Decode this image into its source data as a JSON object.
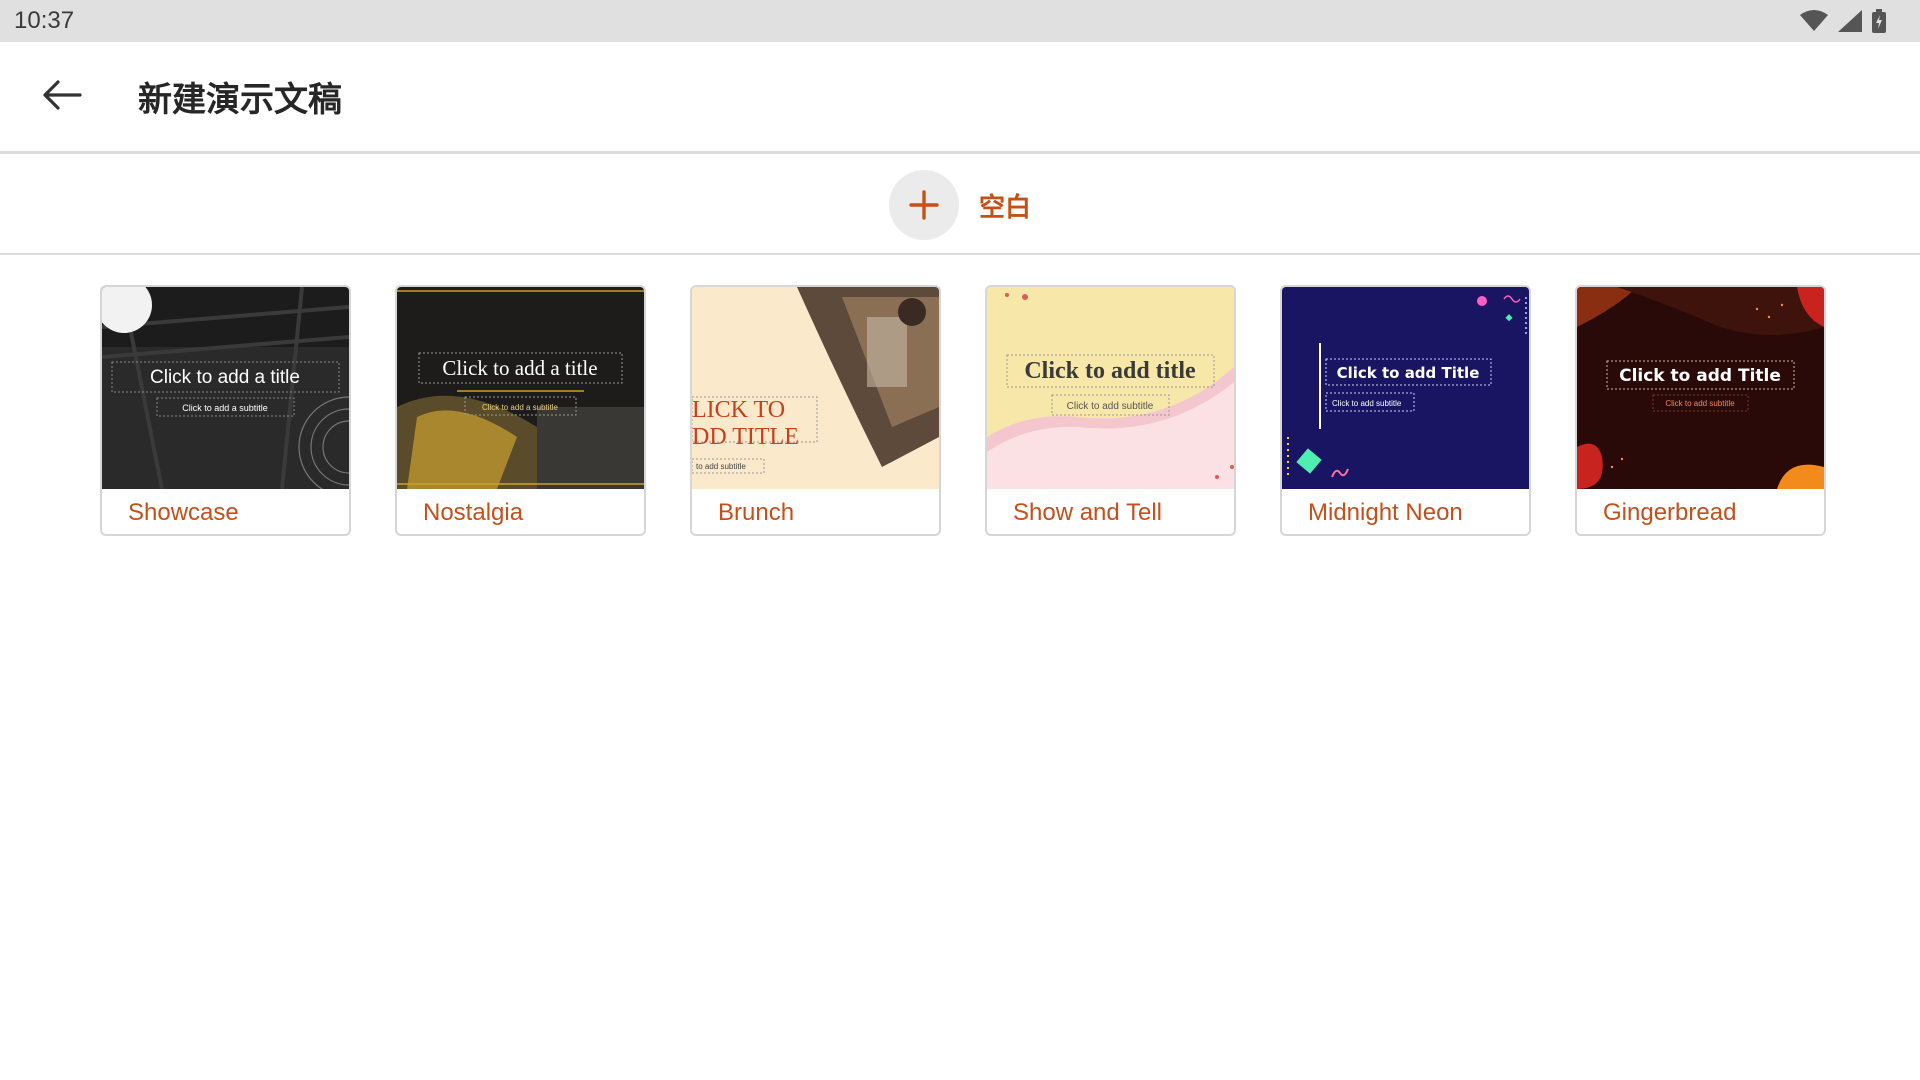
{
  "status_bar": {
    "time": "10:37",
    "icons": [
      "wifi-icon",
      "signal-icon",
      "battery-icon"
    ]
  },
  "app_bar": {
    "back_icon": "arrow-left-icon",
    "title": "新建演示文稿"
  },
  "blank": {
    "icon": "plus-icon",
    "label": "空白"
  },
  "colors": {
    "accent": "#c4501a",
    "divider": "#dcdcdc",
    "status_bar_bg": "#e0e0e0"
  },
  "templates": [
    {
      "name": "Showcase",
      "thumb_title": "Click to add a title",
      "thumb_subtitle": "Click to add a subtitle"
    },
    {
      "name": "Nostalgia",
      "thumb_title": "Click to add a title",
      "thumb_subtitle": "Click to add a subtitle"
    },
    {
      "name": "Brunch",
      "thumb_title_line1": "LICK TO",
      "thumb_title_line2": "DD TITLE",
      "thumb_subtitle": "to add subtitle"
    },
    {
      "name": "Show and Tell",
      "thumb_title": "Click to add title",
      "thumb_subtitle": "Click to add subtitle"
    },
    {
      "name": "Midnight Neon",
      "thumb_title": "Click to add Title",
      "thumb_subtitle": "Click to add subtitle"
    },
    {
      "name": "Gingerbread",
      "thumb_title": "Click to add Title",
      "thumb_subtitle": "Click to add subtitle"
    }
  ]
}
